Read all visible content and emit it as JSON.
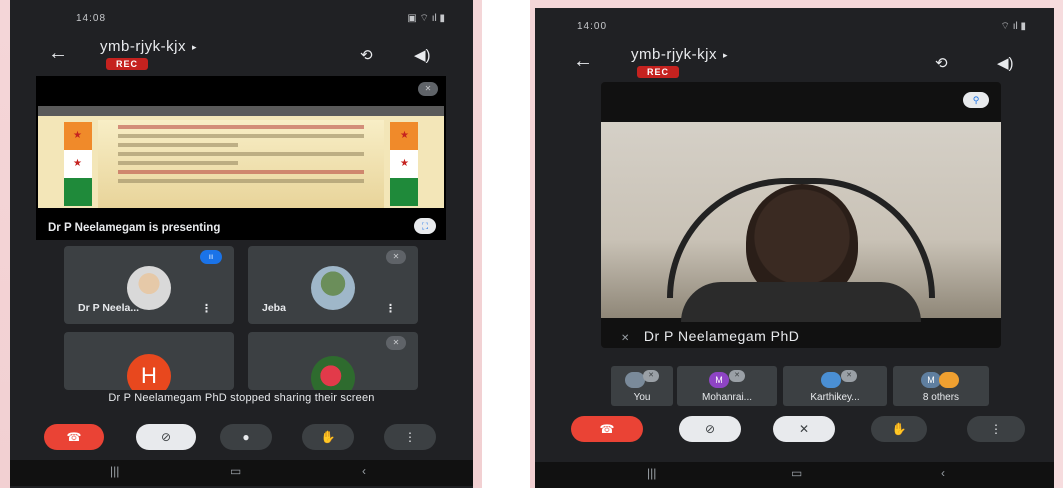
{
  "left": {
    "status": {
      "time": "14:08"
    },
    "meeting": {
      "title": "ymb-rjyk-kjx",
      "rec": "REC"
    },
    "presentation": {
      "caption": "Dr P Neelamegam is presenting"
    },
    "tiles": [
      {
        "name": "Dr P Neela..."
      },
      {
        "name": "Jeba"
      },
      {
        "letter": "H"
      }
    ],
    "toast": "Dr P Neelamegam PhD stopped sharing their screen"
  },
  "right": {
    "status": {
      "time": "14:00"
    },
    "meeting": {
      "title": "ymb-rjyk-kjx",
      "rec": "REC"
    },
    "video": {
      "caption": "Dr P Neelamegam PhD"
    },
    "participants": [
      {
        "label": "You"
      },
      {
        "label": "Mohanrai...",
        "initial": "M"
      },
      {
        "label": "Karthikey..."
      },
      {
        "label": "8 others",
        "initial": "M"
      }
    ]
  },
  "icons": {
    "back": "arrow-left-icon",
    "camera_switch": "camera-switch-icon",
    "speaker": "speaker-icon",
    "end_call": "end-call-icon",
    "camera_off": "camera-off-icon",
    "mic": "mic-icon",
    "raise_hand": "hand-icon",
    "more": "more-vert-icon"
  },
  "colors": {
    "end_call": "#ea4335",
    "rec": "#c5221f",
    "accent": "#1a73e8",
    "tile": "#3c4043",
    "bg": "#202124"
  }
}
